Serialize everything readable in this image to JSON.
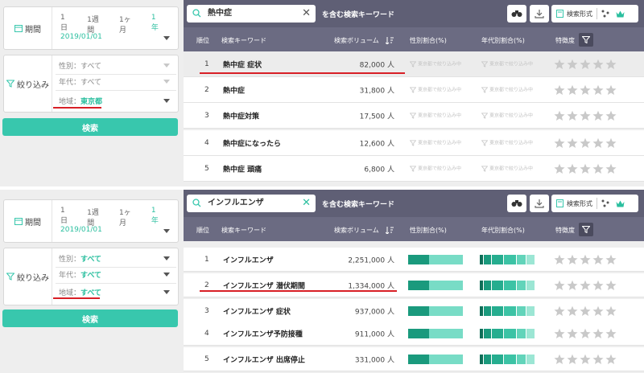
{
  "colors": {
    "accent": "#38c7ad",
    "accent_dark": "#1a9a7d",
    "accent_light": "#78dcc6",
    "header": "#5f5f75",
    "underline": "#d81f26"
  },
  "panels": [
    {
      "sidebar": {
        "period_label": "期間",
        "period_tabs": [
          "1日",
          "1週間",
          "1ヶ月",
          "1年"
        ],
        "date": "2019/01/01",
        "filter_label": "絞り込み",
        "filters": [
          {
            "name": "性別",
            "value": "すべて",
            "sep": "："
          },
          {
            "name": "年代",
            "value": "すべて",
            "sep": "："
          },
          {
            "name": "地域",
            "value": "東京都",
            "sep": "："
          }
        ],
        "search_label": "検索"
      },
      "search": {
        "value": "熱中症",
        "contains": "を含む検索キーワード"
      },
      "format_label": "検索形式",
      "columns": {
        "rank": "順位",
        "keyword": "検索キーワード",
        "volume": "検索ボリューム",
        "gender": "性別割合(%)",
        "age": "年代別割合(%)",
        "feature": "特徴度"
      },
      "ghost_text": "東京都で絞り込み中",
      "rows": [
        {
          "rank": "1",
          "keyword": "熱中症 症状",
          "volume": "82,000 人",
          "stars": 0
        },
        {
          "rank": "2",
          "keyword": "熱中症",
          "volume": "31,800 人",
          "stars": 0
        },
        {
          "rank": "3",
          "keyword": "熱中症対策",
          "volume": "17,500 人",
          "stars": 0
        },
        {
          "rank": "4",
          "keyword": "熱中症になったら",
          "volume": "12,600 人",
          "stars": 0
        },
        {
          "rank": "5",
          "keyword": "熱中症 頭痛",
          "volume": "6,800 人",
          "stars": 0
        }
      ]
    },
    {
      "sidebar": {
        "period_label": "期間",
        "period_tabs": [
          "1日",
          "1週間",
          "1ヶ月",
          "1年"
        ],
        "date": "2019/01/01",
        "filter_label": "絞り込み",
        "filters": [
          {
            "name": "性別",
            "value": "すべて",
            "sep": "："
          },
          {
            "name": "年代",
            "value": "すべて",
            "sep": "："
          },
          {
            "name": "地域",
            "value": "すべて",
            "sep": "："
          }
        ],
        "search_label": "検索"
      },
      "search": {
        "value": "インフルエンザ",
        "contains": "を含む検索キーワード"
      },
      "format_label": "検索形式",
      "columns": {
        "rank": "順位",
        "keyword": "検索キーワード",
        "volume": "検索ボリューム",
        "gender": "性別割合(%)",
        "age": "年代別割合(%)",
        "feature": "特徴度"
      },
      "rows": [
        {
          "rank": "1",
          "keyword": "インフルエンザ",
          "volume": "2,251,000 人",
          "stars": 0
        },
        {
          "rank": "2",
          "keyword": "インフルエンザ 潜伏期間",
          "volume": "1,334,000 人",
          "stars": 0
        },
        {
          "rank": "3",
          "keyword": "インフルエンザ 症状",
          "volume": "937,000 人",
          "stars": 0
        },
        {
          "rank": "4",
          "keyword": "インフルエンザ予防接種",
          "volume": "911,000 人",
          "stars": 0
        },
        {
          "rank": "5",
          "keyword": "インフルエンザ 出席停止",
          "volume": "331,000 人",
          "stars": 0
        }
      ]
    }
  ]
}
